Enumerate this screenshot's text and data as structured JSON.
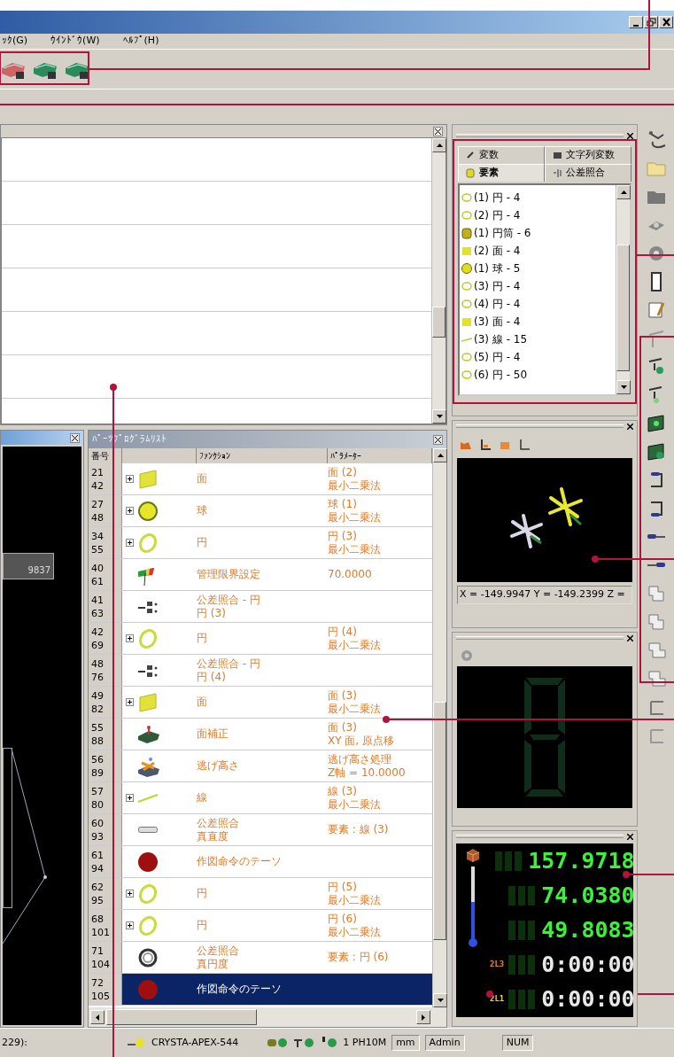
{
  "menu": [
    "ｯｸ(G)",
    "ｳｲﾝﾄﾞｳ(W)",
    "ﾍﾙﾌﾟ(H)"
  ],
  "graphics_window": {
    "label": "9837"
  },
  "part_program_list": {
    "title": "ﾊﾟｰﾂﾌﾟﾛｸﾞﾗﾑﾘｽﾄ",
    "columns": [
      "番号",
      "ﾌｧﾝｸｼｮﾝ",
      "ﾊﾟﾗﾒｰﾀｰ"
    ],
    "rows": [
      {
        "number": [
          "21",
          "42"
        ],
        "kind": "plane",
        "expandable": true,
        "function": [
          "面"
        ],
        "parameter": [
          "面 (2)",
          "最小二乗法"
        ],
        "selected": false
      },
      {
        "number": [
          "27",
          "48"
        ],
        "kind": "sphere",
        "expandable": true,
        "function": [
          "球"
        ],
        "parameter": [
          "球 (1)",
          "最小二乗法"
        ],
        "selected": false
      },
      {
        "number": [
          "34",
          "55"
        ],
        "kind": "circle",
        "expandable": true,
        "function": [
          "円"
        ],
        "parameter": [
          "円 (3)",
          "最小二乗法"
        ],
        "selected": false
      },
      {
        "number": [
          "40",
          "61"
        ],
        "kind": "flag",
        "expandable": false,
        "function": [
          "管理限界設定"
        ],
        "parameter": [
          "70.0000"
        ],
        "selected": false
      },
      {
        "number": [
          "41",
          "63"
        ],
        "kind": "tolerance",
        "expandable": false,
        "function": [
          "公差照合 - 円",
          "円 (3)"
        ],
        "parameter": [],
        "selected": false
      },
      {
        "number": [
          "42",
          "69"
        ],
        "kind": "circle",
        "expandable": true,
        "function": [
          "円"
        ],
        "parameter": [
          "円 (4)",
          "最小二乗法"
        ],
        "selected": false
      },
      {
        "number": [
          "48",
          "76"
        ],
        "kind": "tolerance",
        "expandable": false,
        "function": [
          "公差照合 - 円",
          "円 (4)"
        ],
        "parameter": [],
        "selected": false
      },
      {
        "number": [
          "49",
          "82"
        ],
        "kind": "plane",
        "expandable": true,
        "function": [
          "面"
        ],
        "parameter": [
          "面 (3)",
          "最小二乗法"
        ],
        "selected": false
      },
      {
        "number": [
          "55",
          "88"
        ],
        "kind": "align",
        "expandable": false,
        "function": [
          "面補正"
        ],
        "parameter": [
          "面 (3)",
          "XY 面, 原点移"
        ],
        "selected": false
      },
      {
        "number": [
          "56",
          "89"
        ],
        "kind": "clearance",
        "expandable": false,
        "function": [
          "逃げ高さ"
        ],
        "parameter": [
          "逃げ高さ処理",
          "Z軸 = 10.0000"
        ],
        "selected": false
      },
      {
        "number": [
          "57",
          "80"
        ],
        "kind": "line",
        "expandable": true,
        "function": [
          "線"
        ],
        "parameter": [
          "線 (3)",
          "最小二乗法"
        ],
        "selected": false
      },
      {
        "number": [
          "60",
          "93"
        ],
        "kind": "straightness",
        "expandable": false,
        "function": [
          "公差照合",
          "真直度"
        ],
        "parameter": [
          "要素 : 線 (3)"
        ],
        "selected": false
      },
      {
        "number": [
          "61",
          "94"
        ],
        "kind": "stop",
        "expandable": false,
        "function": [
          "作図命令のテーソ"
        ],
        "parameter": [],
        "selected": false
      },
      {
        "number": [
          "62",
          "95"
        ],
        "kind": "circle",
        "expandable": true,
        "function": [
          "円"
        ],
        "parameter": [
          "円 (5)",
          "最小二乗法"
        ],
        "selected": false
      },
      {
        "number": [
          "68",
          "101"
        ],
        "kind": "circle",
        "expandable": true,
        "function": [
          "円"
        ],
        "parameter": [
          "円 (6)",
          "最小二乗法"
        ],
        "selected": false
      },
      {
        "number": [
          "71",
          "104"
        ],
        "kind": "roundness",
        "expandable": false,
        "function": [
          "公差照合",
          "真円度"
        ],
        "parameter": [
          "要素 : 円 (6)"
        ],
        "selected": false
      },
      {
        "number": [
          "72",
          "105"
        ],
        "kind": "stop",
        "expandable": false,
        "function": [
          "作図命令のテーソ"
        ],
        "parameter": [],
        "selected": true
      }
    ]
  },
  "element_panel": {
    "tabs": [
      {
        "label": "変数",
        "selected": false
      },
      {
        "label": "文字列変数",
        "selected": false
      },
      {
        "label": "要素",
        "selected": true
      },
      {
        "label": "公差照合",
        "selected": false
      }
    ],
    "items": [
      {
        "label": "(1) 円 - 4",
        "kind": "circle"
      },
      {
        "label": "(2) 円 - 4",
        "kind": "circle"
      },
      {
        "label": "(1) 円筒 - 6",
        "kind": "cylinder"
      },
      {
        "label": "(2) 面 - 4",
        "kind": "plane"
      },
      {
        "label": "(1) 球 - 5",
        "kind": "sphere"
      },
      {
        "label": "(3) 円 - 4",
        "kind": "circle"
      },
      {
        "label": "(4) 円 - 4",
        "kind": "circle"
      },
      {
        "label": "(3) 面 - 4",
        "kind": "plane"
      },
      {
        "label": "(3) 線 - 15",
        "kind": "line"
      },
      {
        "label": "(5) 円 - 4",
        "kind": "circle"
      },
      {
        "label": "(6) 円 - 50",
        "kind": "circle"
      }
    ]
  },
  "probe_view": {
    "readout": "X = -149.9947 Y = -149.2399 Z ="
  },
  "counter": {
    "rows": [
      {
        "text": "157.9718",
        "kind": "value"
      },
      {
        "text": "74.0380",
        "kind": "value"
      },
      {
        "text": "49.8083",
        "kind": "value"
      },
      {
        "text": "0:00:00",
        "kind": "timer",
        "tag": "2L3"
      },
      {
        "text": "0:00:00",
        "kind": "timer",
        "tag": "2L1"
      }
    ]
  },
  "status_bar": {
    "left": "229):",
    "machine": "CRYSTA-APEX-544",
    "probe": "1 PH10M",
    "unit": "mm",
    "user": "Admin",
    "num": "NUM"
  }
}
